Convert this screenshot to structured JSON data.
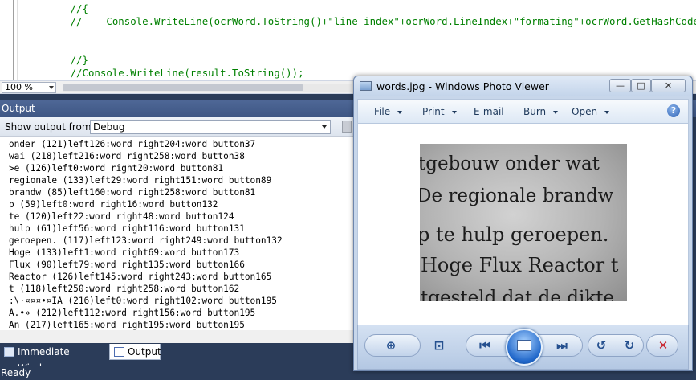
{
  "editor": {
    "code_lines": [
      "          //{",
      "          //    Console.WriteLine(ocrWord.ToString()+\"line index\"+ocrWord.LineIndex+\"formating\"+ocrWord.GetHashCode());",
      "",
      "",
      "          //}",
      "          //Console.WriteLine(result.ToString());"
    ],
    "zoom": "100 %"
  },
  "output": {
    "header": "Output",
    "show_from_label": "Show output from:",
    "source": "Debug",
    "lines": [
      "onder (121)left126:word right204:word button37",
      "wai (218)left216:word right258:word button38",
      ">e (126)left0:word right20:word button81",
      "regionale (133)left29:word right151:word button89",
      "brandw (85)left160:word right258:word button81",
      "p (59)left0:word right16:word button132",
      "te (120)left22:word right48:word button124",
      "hulp (61)left56:word right116:word button131",
      "geroepen. (117)left123:word right249:word button132",
      "Hoge (133)left1:word right69:word button173",
      "Flux (90)left79:word right135:word button166",
      "Reactor (126)left145:word right243:word button165",
      "t (118)left250:word right258:word button162",
      ":\\·¤¤¤•¤IA (216)left0:word right102:word button195",
      "A.•» (212)left112:word right156:word button195",
      "An (217)left165:word right195:word button195"
    ]
  },
  "tabs": {
    "immediate": "Immediate Window",
    "output": "Output"
  },
  "status": {
    "text": "Ready"
  },
  "viewer": {
    "title": "words.jpg - Windows Photo Viewer",
    "menu": {
      "file": "File",
      "print": "Print",
      "email": "E-mail",
      "burn": "Burn",
      "open": "Open"
    },
    "help": "?",
    "photo_lines": [
      "tgebouw onder wat",
      "De regionale brandw",
      "p te hulp geroepen.",
      "Hoge Flux Reactor t",
      "tgesteld dat de dikte"
    ],
    "window_buttons": {
      "minimize": "—",
      "maximize": "□",
      "close": "✕"
    },
    "controls": {
      "zoom": "⊕",
      "fit": "⊡",
      "previous": "⏮",
      "next": "⏭",
      "rotate_ccw": "↺",
      "rotate_cw": "↻",
      "delete": "✕"
    }
  },
  "colors": {
    "comment": "#008000",
    "vs_frame": "#2b3c59",
    "delete_red": "#c8202a"
  }
}
